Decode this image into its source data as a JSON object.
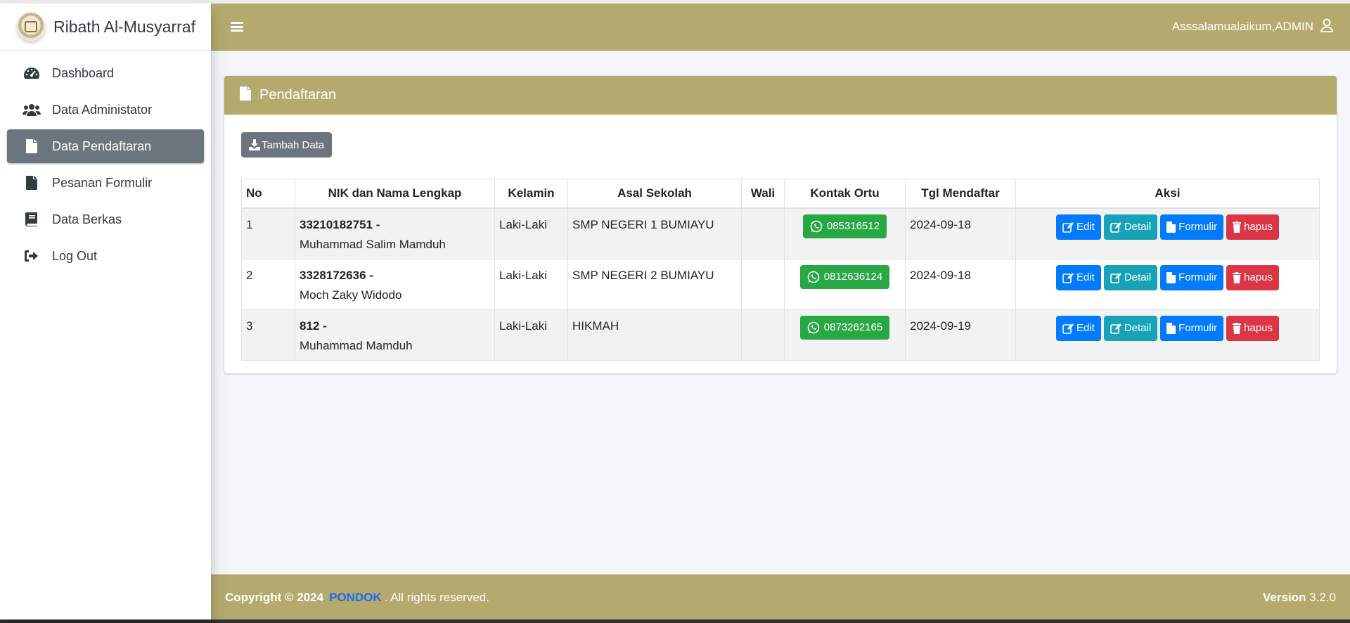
{
  "brand": {
    "name": "Ribath Al-Musyarraf"
  },
  "sidebar": {
    "items": [
      {
        "label": "Dashboard",
        "icon": "tachometer-icon"
      },
      {
        "label": "Data Administator",
        "icon": "users-icon"
      },
      {
        "label": "Data Pendaftaran",
        "icon": "file-icon",
        "active": true
      },
      {
        "label": "Pesanan Formulir",
        "icon": "file-icon"
      },
      {
        "label": "Data Berkas",
        "icon": "book-icon"
      },
      {
        "label": "Log Out",
        "icon": "sign-out-icon"
      }
    ]
  },
  "navbar": {
    "greeting": "Asssalamualaikum,ADMIN"
  },
  "card": {
    "title": "Pendaftaran",
    "add_button": "Tambah Data",
    "columns": [
      "No",
      "NIK dan Nama Lengkap",
      "Kelamin",
      "Asal Sekolah",
      "Wali",
      "Kontak Ortu",
      "Tgl Mendaftar",
      "Aksi"
    ],
    "rows": [
      {
        "no": "1",
        "nik": "33210182751 -",
        "name": "Muhammad Salim Mamduh",
        "gender": "Laki-Laki",
        "school": "SMP NEGERI 1 BUMIAYU",
        "wali": "",
        "phone": "085316512",
        "date": "2024-09-18"
      },
      {
        "no": "2",
        "nik": "3328172636 -",
        "name": "Moch Zaky Widodo",
        "gender": "Laki-Laki",
        "school": "SMP NEGERI 2 BUMIAYU",
        "wali": "",
        "phone": "0812636124",
        "date": "2024-09-18"
      },
      {
        "no": "3",
        "nik": "812 -",
        "name": "Muhammad Mamduh",
        "gender": "Laki-Laki",
        "school": "HIKMAH",
        "wali": "",
        "phone": "0873262165",
        "date": "2024-09-19"
      }
    ],
    "actions": {
      "edit": "Edit",
      "detail": "Detail",
      "form": "Formulir",
      "delete": "hapus"
    }
  },
  "footer": {
    "copyright": "Copyright © 2024",
    "brand": "PONDOK",
    "rights": ". All rights reserved.",
    "version_label": "Version",
    "version": "3.2.0"
  },
  "colors": {
    "theme": "#b5aa6e",
    "active": "#6c757d",
    "primary": "#007bff",
    "info": "#17a2b8",
    "success": "#28a745",
    "danger": "#dc3545"
  }
}
